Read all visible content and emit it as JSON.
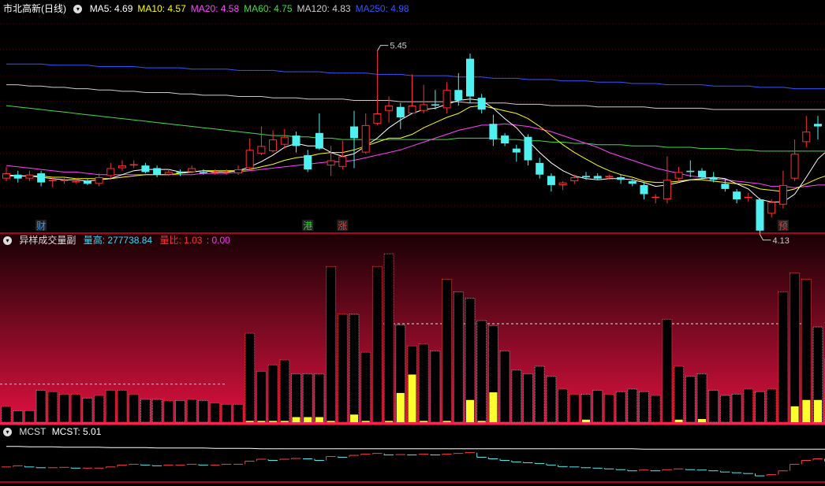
{
  "main": {
    "title": "市北高新(日线)",
    "ma_labels": [
      {
        "text": "MA5: 4.69",
        "color": "#ffffff"
      },
      {
        "text": "MA10: 4.57",
        "color": "#ffff00"
      },
      {
        "text": "MA20: 4.58",
        "color": "#ff44ff"
      },
      {
        "text": "MA60: 4.75",
        "color": "#44dd44"
      },
      {
        "text": "MA120: 4.83",
        "color": "#cccccc"
      },
      {
        "text": "MA250: 4.98",
        "color": "#3355ff"
      }
    ],
    "high_label": "5.45",
    "low_label": "4.13",
    "markers": [
      {
        "idx": 3,
        "text": "财",
        "color": "#3399ff"
      },
      {
        "idx": 26,
        "text": "港",
        "color": "#33cc33"
      },
      {
        "idx": 29,
        "text": "涨",
        "color": "#ff3333"
      },
      {
        "idx": 67,
        "text": "预",
        "color": "#ff3333"
      }
    ]
  },
  "volume_panel": {
    "title": "异样成交量副",
    "high_label": "量高: 277738.84",
    "ratio_label": "量比: 1.03",
    "ratio_value": ": 0.00"
  },
  "mcst_panel": {
    "title": "MCST",
    "value_label": "MCST: 5.01"
  },
  "chart_data": {
    "type": "candlestick",
    "ylim": [
      4.05,
      5.55
    ],
    "candles": [
      [
        4.3,
        4.34,
        4.39,
        4.28
      ],
      [
        4.33,
        4.3,
        4.36,
        4.27
      ],
      [
        4.3,
        4.33,
        4.36,
        4.28
      ],
      [
        4.34,
        4.27,
        4.36,
        4.24
      ],
      [
        4.28,
        4.29,
        4.31,
        4.23
      ],
      [
        4.29,
        4.29,
        4.31,
        4.26
      ],
      [
        4.28,
        4.28,
        4.3,
        4.26
      ],
      [
        4.28,
        4.26,
        4.3,
        4.25
      ],
      [
        4.26,
        4.31,
        4.34,
        4.24
      ],
      [
        4.32,
        4.38,
        4.42,
        4.3
      ],
      [
        4.38,
        4.4,
        4.44,
        4.36
      ],
      [
        4.4,
        4.41,
        4.44,
        4.38
      ],
      [
        4.4,
        4.35,
        4.42,
        4.34
      ],
      [
        4.38,
        4.33,
        4.4,
        4.31
      ],
      [
        4.33,
        4.35,
        4.37,
        4.32
      ],
      [
        4.35,
        4.34,
        4.37,
        4.32
      ],
      [
        4.35,
        4.38,
        4.4,
        4.34
      ],
      [
        4.35,
        4.34,
        4.37,
        4.33
      ],
      [
        4.35,
        4.35,
        4.37,
        4.33
      ],
      [
        4.34,
        4.35,
        4.37,
        4.33
      ],
      [
        4.34,
        4.37,
        4.4,
        4.33
      ],
      [
        4.38,
        4.52,
        4.61,
        4.37
      ],
      [
        4.49,
        4.55,
        4.7,
        4.48
      ],
      [
        4.51,
        4.6,
        4.67,
        4.5
      ],
      [
        4.56,
        4.62,
        4.68,
        4.53
      ],
      [
        4.63,
        4.55,
        4.66,
        4.5
      ],
      [
        4.48,
        4.37,
        4.52,
        4.35
      ],
      [
        4.65,
        4.53,
        4.8,
        4.52
      ],
      [
        4.4,
        4.44,
        4.55,
        4.32
      ],
      [
        4.39,
        4.47,
        4.59,
        4.37
      ],
      [
        4.7,
        4.61,
        4.82,
        4.38
      ],
      [
        4.5,
        4.71,
        4.8,
        4.49
      ],
      [
        4.72,
        4.8,
        5.28,
        4.71
      ],
      [
        4.82,
        4.86,
        4.93,
        4.73
      ],
      [
        4.85,
        4.77,
        4.88,
        4.68
      ],
      [
        4.8,
        4.86,
        5.1,
        4.8
      ],
      [
        4.82,
        4.87,
        5.02,
        4.8
      ],
      [
        4.87,
        4.86,
        4.98,
        4.83
      ],
      [
        4.84,
        4.98,
        5.04,
        4.8
      ],
      [
        4.98,
        4.9,
        5.11,
        4.86
      ],
      [
        5.22,
        4.93,
        5.26,
        4.88
      ],
      [
        4.92,
        4.83,
        4.95,
        4.8
      ],
      [
        4.72,
        4.6,
        4.79,
        4.55
      ],
      [
        4.63,
        4.57,
        4.65,
        4.55
      ],
      [
        4.53,
        4.5,
        4.56,
        4.43
      ],
      [
        4.62,
        4.44,
        4.64,
        4.4
      ],
      [
        4.42,
        4.33,
        4.46,
        4.3
      ],
      [
        4.32,
        4.25,
        4.34,
        4.2
      ],
      [
        4.25,
        4.27,
        4.28,
        4.21
      ],
      [
        4.28,
        4.31,
        4.33,
        4.26
      ],
      [
        4.32,
        4.31,
        4.35,
        4.29
      ],
      [
        4.32,
        4.3,
        4.34,
        4.29
      ],
      [
        4.31,
        4.32,
        4.33,
        4.3
      ],
      [
        4.31,
        4.29,
        4.33,
        4.26
      ],
      [
        4.28,
        4.26,
        4.3,
        4.24
      ],
      [
        4.25,
        4.18,
        4.27,
        4.14
      ],
      [
        4.16,
        4.16,
        4.18,
        4.11
      ],
      [
        4.14,
        4.29,
        4.47,
        4.11
      ],
      [
        4.3,
        4.35,
        4.39,
        4.28
      ],
      [
        4.36,
        4.35,
        4.44,
        4.31
      ],
      [
        4.36,
        4.31,
        4.38,
        4.29
      ],
      [
        4.31,
        4.29,
        4.35,
        4.27
      ],
      [
        4.26,
        4.22,
        4.3,
        4.2
      ],
      [
        4.2,
        4.14,
        4.22,
        4.11
      ],
      [
        4.15,
        4.16,
        4.19,
        4.12
      ],
      [
        4.14,
        3.9,
        4.15,
        3.87
      ],
      [
        4.03,
        4.12,
        4.14,
        4.0
      ],
      [
        4.1,
        4.25,
        4.36,
        4.07
      ],
      [
        4.3,
        4.49,
        4.6,
        4.28
      ],
      [
        4.58,
        4.66,
        4.78,
        4.54
      ],
      [
        4.72,
        4.7,
        4.78,
        4.6
      ],
      [
        4.74,
        4.55,
        4.76,
        4.53
      ],
      [
        4.42,
        4.4,
        4.44,
        4.3
      ],
      [
        4.3,
        4.1,
        4.32,
        4.08
      ]
    ],
    "ma_series": [
      {
        "name": "MA5",
        "color": "#ffffff",
        "values": [
          4.33,
          4.32,
          4.32,
          4.31,
          4.3,
          4.29,
          4.29,
          4.28,
          4.29,
          4.3,
          4.33,
          4.36,
          4.37,
          4.37,
          4.37,
          4.35,
          4.35,
          4.36,
          4.35,
          4.35,
          4.36,
          4.39,
          4.43,
          4.48,
          4.54,
          4.57,
          4.55,
          4.55,
          4.5,
          4.47,
          4.49,
          4.55,
          4.61,
          4.69,
          4.75,
          4.8,
          4.83,
          4.84,
          4.87,
          4.9,
          4.91,
          4.9,
          4.84,
          4.76,
          4.69,
          4.59,
          4.5,
          4.42,
          4.36,
          4.32,
          4.3,
          4.29,
          4.3,
          4.3,
          4.29,
          4.27,
          4.24,
          4.25,
          4.27,
          4.29,
          4.3,
          4.31,
          4.3,
          4.26,
          4.22,
          4.14,
          4.12,
          4.12,
          4.18,
          4.31,
          4.45,
          4.53,
          4.56,
          4.53
        ]
      },
      {
        "name": "MA10",
        "color": "#ffff00",
        "values": [
          4.32,
          4.32,
          4.32,
          4.32,
          4.31,
          4.31,
          4.3,
          4.3,
          4.3,
          4.3,
          4.31,
          4.32,
          4.33,
          4.33,
          4.33,
          4.34,
          4.35,
          4.36,
          4.36,
          4.36,
          4.36,
          4.37,
          4.39,
          4.41,
          4.44,
          4.46,
          4.47,
          4.49,
          4.5,
          4.5,
          4.52,
          4.55,
          4.58,
          4.61,
          4.61,
          4.64,
          4.69,
          4.73,
          4.77,
          4.8,
          4.85,
          4.86,
          4.84,
          4.82,
          4.8,
          4.76,
          4.7,
          4.63,
          4.56,
          4.5,
          4.45,
          4.4,
          4.36,
          4.33,
          4.31,
          4.28,
          4.27,
          4.27,
          4.28,
          4.29,
          4.29,
          4.28,
          4.27,
          4.26,
          4.25,
          4.22,
          4.21,
          4.2,
          4.22,
          4.26,
          4.3,
          4.33,
          4.36,
          4.38
        ]
      },
      {
        "name": "MA20",
        "color": "#ff44ff",
        "values": [
          4.4,
          4.39,
          4.38,
          4.37,
          4.36,
          4.35,
          4.35,
          4.34,
          4.33,
          4.33,
          4.33,
          4.33,
          4.33,
          4.33,
          4.33,
          4.33,
          4.33,
          4.34,
          4.34,
          4.34,
          4.35,
          4.36,
          4.37,
          4.38,
          4.39,
          4.4,
          4.41,
          4.42,
          4.43,
          4.43,
          4.44,
          4.46,
          4.48,
          4.5,
          4.52,
          4.55,
          4.58,
          4.61,
          4.64,
          4.67,
          4.69,
          4.71,
          4.71,
          4.72,
          4.71,
          4.7,
          4.68,
          4.66,
          4.63,
          4.6,
          4.57,
          4.54,
          4.5,
          4.47,
          4.44,
          4.41,
          4.38,
          4.36,
          4.34,
          4.32,
          4.31,
          4.3,
          4.29,
          4.28,
          4.27,
          4.26,
          4.24,
          4.24,
          4.23,
          4.24,
          4.25,
          4.25,
          4.26,
          4.26
        ]
      },
      {
        "name": "MA60",
        "color": "#44dd44",
        "values": [
          4.86,
          4.85,
          4.84,
          4.83,
          4.82,
          4.81,
          4.8,
          4.79,
          4.78,
          4.77,
          4.76,
          4.75,
          4.74,
          4.73,
          4.72,
          4.71,
          4.7,
          4.69,
          4.68,
          4.67,
          4.66,
          4.65,
          4.64,
          4.63,
          4.63,
          4.62,
          4.62,
          4.61,
          4.61,
          4.6,
          4.6,
          4.6,
          4.6,
          4.6,
          4.6,
          4.6,
          4.6,
          4.6,
          4.6,
          4.61,
          4.61,
          4.61,
          4.61,
          4.6,
          4.6,
          4.59,
          4.59,
          4.58,
          4.58,
          4.57,
          4.57,
          4.56,
          4.56,
          4.56,
          4.55,
          4.55,
          4.55,
          4.54,
          4.54,
          4.54,
          4.53,
          4.53,
          4.53,
          4.52,
          4.52,
          4.51,
          4.51,
          4.51,
          4.51,
          4.51,
          4.51,
          4.51,
          4.51,
          4.51
        ]
      },
      {
        "name": "MA120",
        "color": "#cccccc",
        "values": [
          5.02,
          5.02,
          5.01,
          5.01,
          5.0,
          5.0,
          4.99,
          4.99,
          4.98,
          4.98,
          4.97,
          4.97,
          4.96,
          4.96,
          4.96,
          4.95,
          4.95,
          4.94,
          4.94,
          4.94,
          4.93,
          4.93,
          4.93,
          4.92,
          4.92,
          4.92,
          4.91,
          4.91,
          4.91,
          4.91,
          4.9,
          4.9,
          4.9,
          4.9,
          4.89,
          4.89,
          4.89,
          4.89,
          4.89,
          4.89,
          4.88,
          4.88,
          4.88,
          4.88,
          4.87,
          4.87,
          4.87,
          4.86,
          4.86,
          4.86,
          4.86,
          4.85,
          4.85,
          4.85,
          4.85,
          4.85,
          4.84,
          4.84,
          4.84,
          4.84,
          4.84,
          4.83,
          4.83,
          4.83,
          4.83,
          4.83,
          4.83,
          4.83,
          4.83,
          4.83,
          4.83,
          4.83,
          4.83,
          4.83
        ]
      },
      {
        "name": "MA250",
        "color": "#3355ff",
        "values": [
          5.18,
          5.18,
          5.18,
          5.18,
          5.17,
          5.17,
          5.17,
          5.17,
          5.16,
          5.16,
          5.16,
          5.16,
          5.15,
          5.15,
          5.15,
          5.15,
          5.14,
          5.14,
          5.14,
          5.14,
          5.13,
          5.13,
          5.13,
          5.13,
          5.12,
          5.12,
          5.12,
          5.12,
          5.11,
          5.11,
          5.11,
          5.11,
          5.1,
          5.1,
          5.1,
          5.09,
          5.09,
          5.09,
          5.09,
          5.08,
          5.08,
          5.08,
          5.07,
          5.07,
          5.07,
          5.06,
          5.06,
          5.06,
          5.05,
          5.05,
          5.05,
          5.04,
          5.04,
          5.04,
          5.03,
          5.03,
          5.03,
          5.02,
          5.02,
          5.02,
          5.02,
          5.01,
          5.01,
          5.01,
          5.01,
          5.0,
          5.0,
          5.0,
          4.99,
          4.99,
          4.99,
          4.99,
          4.98,
          4.98
        ]
      }
    ],
    "volume": {
      "ylim": [
        0,
        277738.84
      ],
      "values": [
        25000,
        18000,
        18000,
        50000,
        48000,
        44000,
        44000,
        38000,
        42000,
        50000,
        50000,
        44000,
        36000,
        36000,
        34000,
        34000,
        36000,
        34000,
        30000,
        28000,
        28000,
        140000,
        80000,
        90000,
        98000,
        76000,
        76000,
        76000,
        245000,
        170000,
        170000,
        110000,
        245000,
        265000,
        153000,
        120000,
        123000,
        112000,
        225000,
        205000,
        195000,
        160000,
        152000,
        112000,
        82000,
        76000,
        88000,
        72000,
        52000,
        44000,
        44000,
        50000,
        44000,
        48000,
        52000,
        48000,
        42000,
        162000,
        88000,
        72000,
        76000,
        50000,
        42000,
        44000,
        52000,
        48000,
        52000,
        205000,
        235000,
        225000,
        150000,
        100000,
        120000,
        80000
      ],
      "highlight": [
        [
          21,
          2000
        ],
        [
          22,
          2000
        ],
        [
          23,
          2000
        ],
        [
          24,
          2000
        ],
        [
          25,
          8000
        ],
        [
          26,
          8000
        ],
        [
          27,
          8000
        ],
        [
          28,
          2000
        ],
        [
          30,
          12000
        ],
        [
          31,
          2000
        ],
        [
          33,
          2000
        ],
        [
          34,
          46000
        ],
        [
          35,
          75000
        ],
        [
          36,
          2000
        ],
        [
          38,
          2000
        ],
        [
          40,
          35000
        ],
        [
          41,
          2000
        ],
        [
          42,
          47000
        ],
        [
          50,
          4000
        ],
        [
          58,
          4000
        ],
        [
          60,
          5000
        ],
        [
          68,
          25000
        ],
        [
          69,
          35000
        ],
        [
          70,
          35000
        ]
      ],
      "avg_ref": 60000,
      "avg_ref2": 155000
    },
    "mcst": {
      "ylim": [
        4.2,
        5.3
      ],
      "line_values": [
        5.08,
        5.08,
        5.07,
        5.07,
        5.07,
        5.06,
        5.06,
        5.06,
        5.06,
        5.05,
        5.05,
        5.05,
        5.05,
        5.04,
        5.04,
        5.04,
        5.04,
        5.04,
        5.03,
        5.03,
        5.03,
        5.03,
        5.02,
        5.02,
        5.02,
        5.02,
        5.02,
        5.02,
        5.02,
        5.02,
        5.02,
        5.02,
        5.02,
        5.02,
        5.02,
        5.02,
        5.02,
        5.02,
        5.02,
        5.02,
        5.02,
        5.02,
        5.02,
        5.02,
        5.02,
        5.02,
        5.02,
        5.02,
        5.02,
        5.02,
        5.02,
        5.02,
        5.02,
        5.02,
        5.02,
        5.01,
        5.01,
        5.01,
        5.01,
        5.01,
        5.01,
        5.01,
        5.01,
        5.01,
        5.01,
        5.01,
        5.01,
        5.01,
        5.01,
        5.01,
        5.01,
        5.01,
        5.01,
        5.01
      ],
      "steps": [
        4.55,
        4.58,
        4.55,
        4.53,
        4.53,
        4.54,
        4.52,
        4.52,
        4.52,
        4.55,
        4.6,
        4.62,
        4.6,
        4.58,
        4.6,
        4.6,
        4.62,
        4.6,
        4.6,
        4.62,
        4.62,
        4.7,
        4.75,
        4.72,
        4.75,
        4.77,
        4.76,
        4.72,
        4.82,
        4.8,
        4.85,
        4.88,
        4.9,
        4.86,
        4.87,
        4.86,
        4.88,
        4.86,
        4.88,
        4.9,
        4.92,
        4.8,
        4.76,
        4.72,
        4.68,
        4.66,
        4.64,
        4.6,
        4.56,
        4.55,
        4.53,
        4.52,
        4.5,
        4.48,
        4.45,
        4.47,
        4.45,
        4.48,
        4.5,
        4.48,
        4.47,
        4.45,
        4.42,
        4.4,
        4.38,
        4.32,
        4.35,
        4.45,
        4.62,
        4.72,
        4.76,
        4.7,
        4.55,
        4.5
      ]
    }
  }
}
